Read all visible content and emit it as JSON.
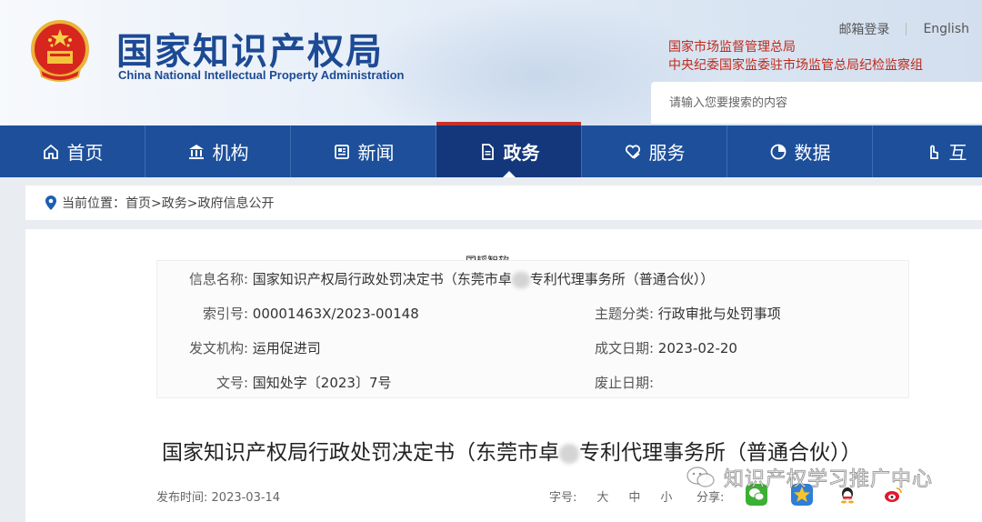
{
  "header": {
    "title": "国家知识产权局",
    "subtitle": "China National Intellectual Property Administration",
    "top_links": [
      "邮箱登录",
      "English"
    ],
    "org_links": [
      "国家市场监督管理总局",
      "中央纪委国家监委驻市场监管总局纪检监察组"
    ],
    "search_placeholder": "请输入您要搜索的内容"
  },
  "nav": {
    "items": [
      {
        "label": "首页",
        "icon": "home-icon"
      },
      {
        "label": "机构",
        "icon": "building-icon"
      },
      {
        "label": "新闻",
        "icon": "newspaper-icon"
      },
      {
        "label": "政务",
        "icon": "document-icon",
        "active": true
      },
      {
        "label": "服务",
        "icon": "heart-hand-icon"
      },
      {
        "label": "数据",
        "icon": "pie-chart-icon"
      },
      {
        "label": "互",
        "icon": "hand-pointer-icon"
      }
    ]
  },
  "breadcrumb": {
    "prefix": "当前位置：",
    "path": "首页>政务>政府信息公开"
  },
  "watermark_label": "国韬智软",
  "info": {
    "name_label": "信息名称:",
    "name_value_a": "国家知识产权局行政处罚决定书（东莞市卓",
    "name_value_b": "专利代理事务所（普通合伙））",
    "index_label": "索引号:",
    "index_value": "00001463X/2023-00148",
    "topic_label": "主题分类:",
    "topic_value": "行政审批与处罚事项",
    "issuer_label": "发文机构:",
    "issuer_value": "运用促进司",
    "date_label": "成文日期:",
    "date_value": "2023-02-20",
    "docno_label": "文号:",
    "docno_value": "国知处字〔2023〕7号",
    "abolish_label": "废止日期:",
    "abolish_value": ""
  },
  "document": {
    "title_a": "国家知识产权局行政处罚决定书（东莞市卓",
    "title_b": "专利代理事务所（普通合伙））",
    "publish_label": "发布时间:",
    "publish_value": "2023-03-14",
    "fontsize_label": "字号:",
    "fontsize_options": [
      "大",
      "中",
      "小"
    ],
    "share_label": "分享:"
  },
  "overlay_watermark": "知识产权学习推广中心",
  "colors": {
    "brand_blue": "#1d4f9b",
    "nav_active": "#13377a",
    "accent_red": "#c8302a"
  }
}
